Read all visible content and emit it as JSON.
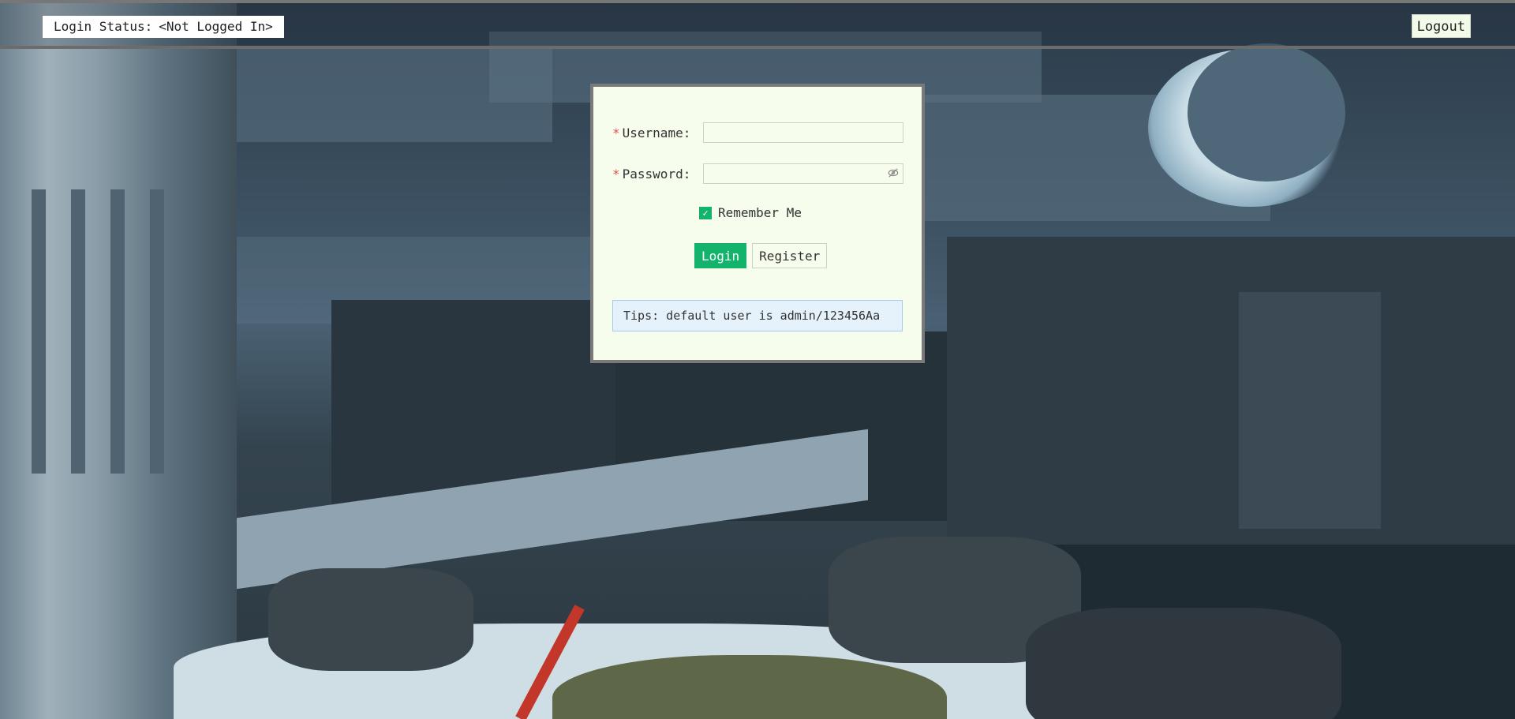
{
  "header": {
    "login_status_label": "Login Status:",
    "login_status_value": "<Not Logged In>",
    "logout_label": "Logout"
  },
  "login_form": {
    "username_label": "Username:",
    "username_value": "",
    "password_label": "Password:",
    "password_value": "",
    "required_marker": "*",
    "remember_label": "Remember Me",
    "remember_checked": true,
    "login_button": "Login",
    "register_button": "Register",
    "tips": "Tips: default user is admin/123456Aa"
  },
  "icons": {
    "password_toggle": "eye-slash-icon",
    "checkbox_check": "check-icon"
  },
  "colors": {
    "accent": "#13b36b",
    "panel_bg": "#f6fdec",
    "tips_bg": "#e6f2fb",
    "tips_border": "#a8c9e6",
    "required": "#e05050"
  }
}
